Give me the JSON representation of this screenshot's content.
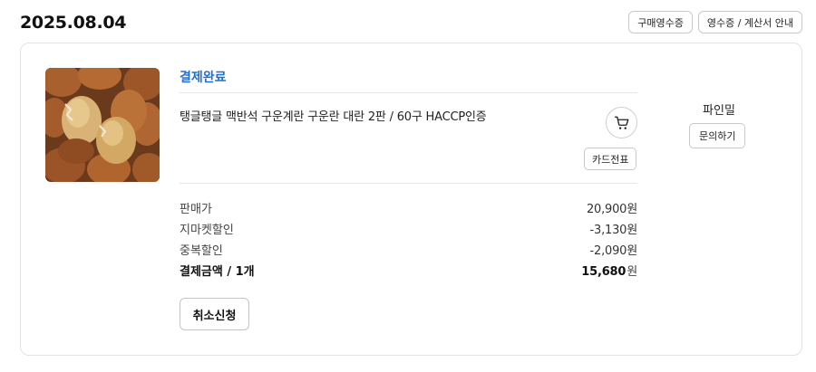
{
  "order": {
    "date": "2025.08.04",
    "receipt_button_label": "구매영수증",
    "tax_invoice_button_label": "영수증 / 계산서 안내"
  },
  "item": {
    "status": "결제완료",
    "product_name": "탱글탱글 맥반석 구운계란 구운란 대란 2판 / 60구 HACCP인증",
    "card_receipt_label": "카드전표",
    "cart_icon": "cart-icon"
  },
  "seller": {
    "name": "파인밀",
    "inquiry_label": "문의하기"
  },
  "prices": {
    "rows": [
      {
        "label": "판매가",
        "value": "20,900원"
      },
      {
        "label": "지마켓할인",
        "value": "-3,130원"
      },
      {
        "label": "중복할인",
        "value": "-2,090원"
      }
    ],
    "total_label": "결제금액 / 1개",
    "total_amount": "15,680",
    "total_unit": "원"
  },
  "actions": {
    "cancel_label": "취소신청"
  },
  "colors": {
    "status": "#1f6fd6",
    "border": "#e2e2e2"
  }
}
